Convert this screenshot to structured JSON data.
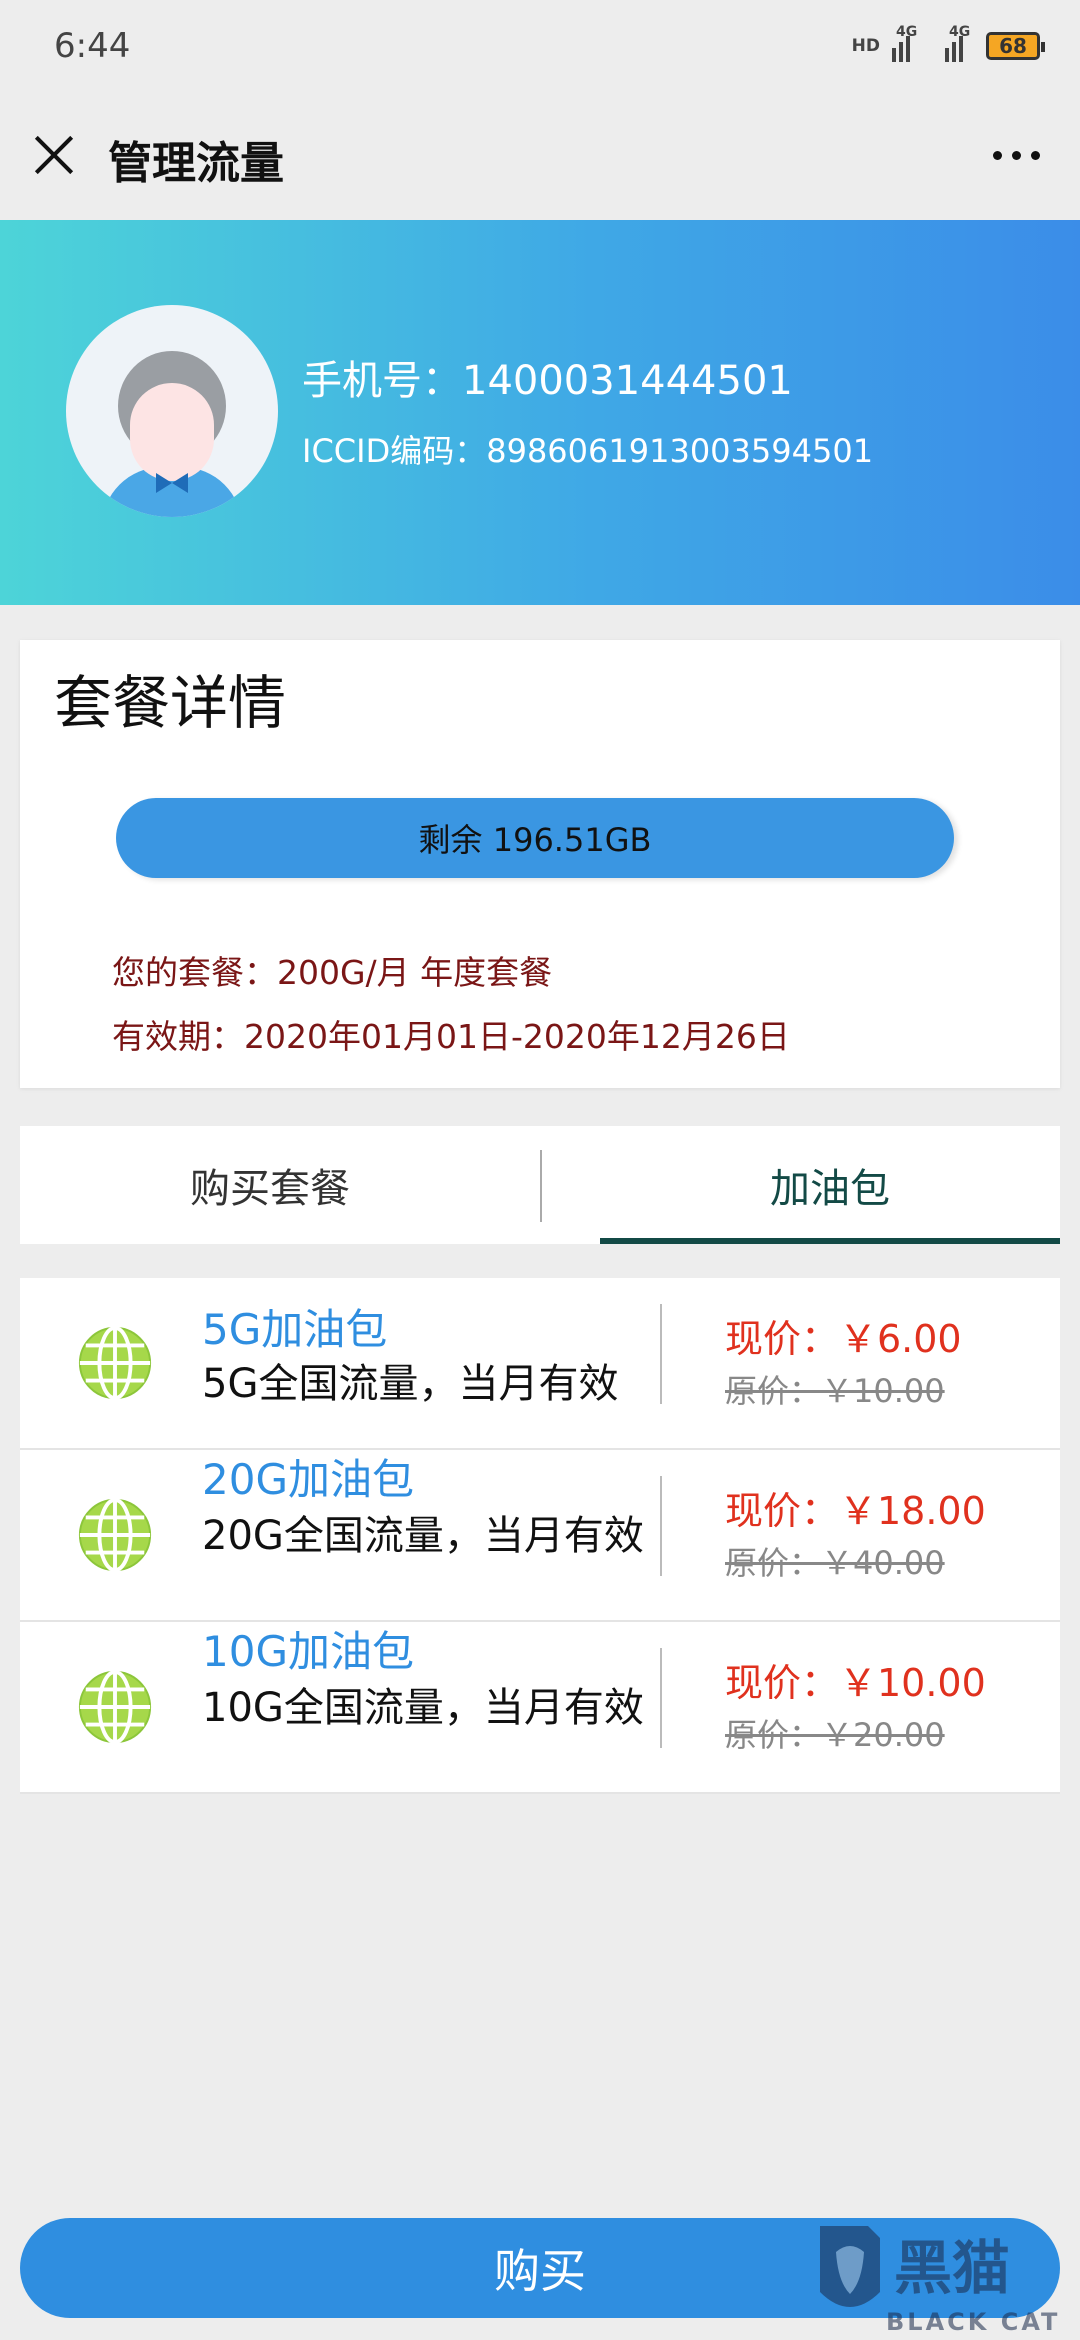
{
  "status_bar": {
    "time": "6:44",
    "signal1_tag": "4G",
    "signal1_prefix": "HD",
    "signal2_tag": "4G",
    "battery": "68"
  },
  "title_bar": {
    "title": "管理流量"
  },
  "profile": {
    "phone_label": "手机号：",
    "phone": "1400031444501",
    "iccid_label": "ICCID编码：",
    "iccid": "89860619130035945​01"
  },
  "package": {
    "title": "套餐详情",
    "remaining": "剩余 196.51GB",
    "plan": "您的套餐：200G/月 年度套餐",
    "validity": "有效期：2020年01月01日-2020年12月26日"
  },
  "tabs": [
    {
      "label": "购买套餐",
      "active": false
    },
    {
      "label": "加油包",
      "active": true
    }
  ],
  "addons": [
    {
      "name": "5G加油包",
      "desc": "5G全国流量，当月有效",
      "price_now": "现价：￥6.00",
      "price_orig": "原价：￥10.00"
    },
    {
      "name": "20G加油包",
      "desc": "20G全国流量，当月有效",
      "price_now": "现价：￥18.00",
      "price_orig": "原价：￥40.00"
    },
    {
      "name": "10G加油包",
      "desc": "10G全国流量，当月有效",
      "price_now": "现价：￥10.00",
      "price_orig": "原价：￥20.00"
    }
  ],
  "buy_button": "购买",
  "watermark": {
    "text_cn": "黑猫",
    "text_en": "BLACK CAT"
  },
  "colors": {
    "accent": "#2f8ee0",
    "price": "#e0311e",
    "plan_text": "#7a1616",
    "tab_active": "#134a46"
  }
}
